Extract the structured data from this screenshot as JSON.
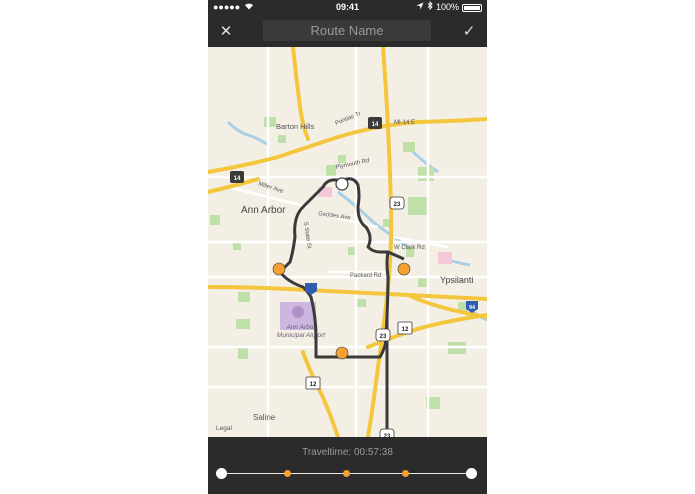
{
  "status_bar": {
    "time": "09:41",
    "battery": "100%"
  },
  "nav": {
    "route_name_placeholder": "Route Name",
    "close_symbol": "✕",
    "confirm_symbol": "✓"
  },
  "map": {
    "labels": {
      "barton_hills": "Barton Hills",
      "pontiac_tr": "Pontiac Tr",
      "mi14e": "MI-14 E",
      "plymouth_rd": "Plymouth Rd",
      "miller_ave": "Miller Ave",
      "ann_arbor": "Ann Arbor",
      "geddes_ave": "Geddes Ave",
      "s_state_st": "S State St",
      "w_clark_rd": "W Clark Rd",
      "packard_rd": "Packard Rd",
      "ypsilanti": "Ypsilanti",
      "airport_line1": "Ann Arbor",
      "airport_line2": "Municipal Airport",
      "saline": "Saline",
      "legal": "Legal"
    },
    "shields": {
      "us23_a": "23",
      "us23_b": "23",
      "us23_c": "23",
      "us12_a": "12",
      "us12_b": "12",
      "i14_a": "14",
      "i14_b": "14",
      "i94": "94"
    }
  },
  "footer": {
    "traveltime": "Traveltime: 00:57:38"
  },
  "colors": {
    "route": "#3a3a3a",
    "stop": "#f5a030",
    "highway": "#f4c63d",
    "background_dark": "#2b2b2b"
  }
}
